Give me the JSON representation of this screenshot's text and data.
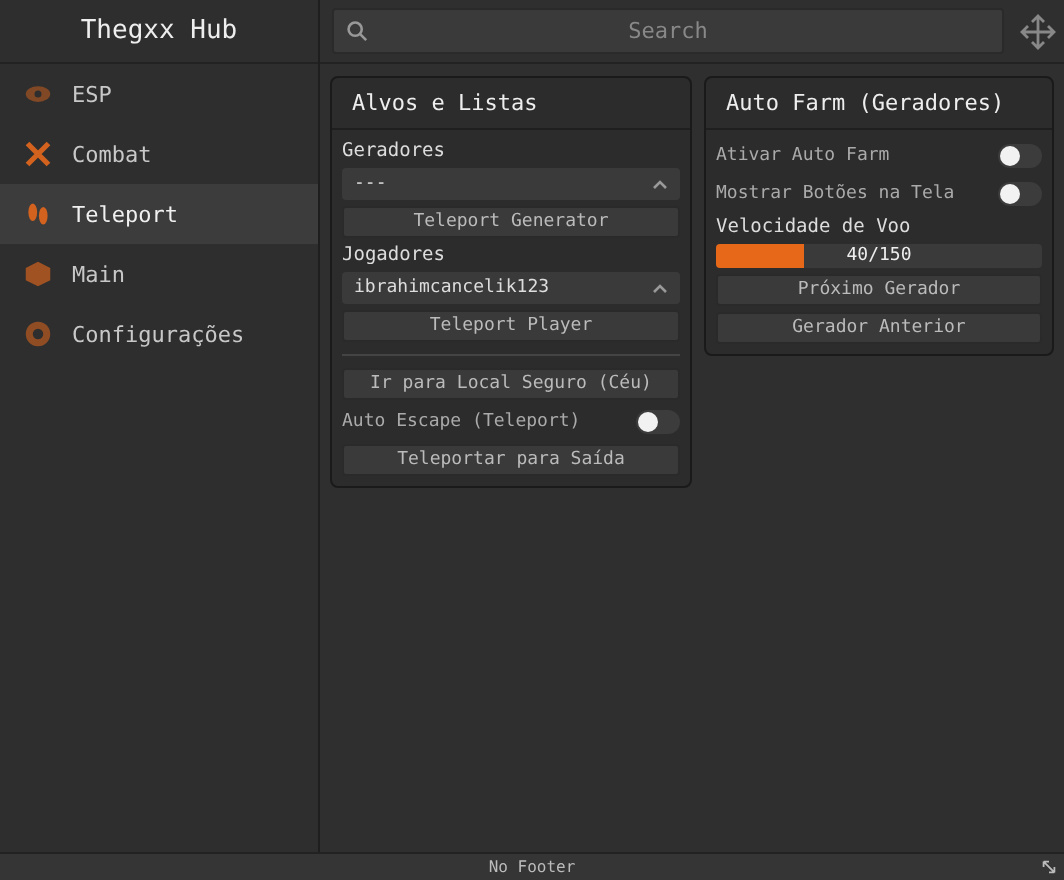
{
  "sidebar": {
    "title": "Thegxx Hub",
    "items": [
      {
        "label": "ESP",
        "selected": false
      },
      {
        "label": "Combat",
        "selected": false
      },
      {
        "label": "Teleport",
        "selected": true
      },
      {
        "label": "Main",
        "selected": false
      },
      {
        "label": "Configurações",
        "selected": false
      }
    ]
  },
  "search": {
    "placeholder": "Search"
  },
  "panels": [
    {
      "title": "Alvos e Listas",
      "items": [
        {
          "kind": "label",
          "text": "Geradores"
        },
        {
          "kind": "dropdown",
          "value": "---"
        },
        {
          "kind": "button",
          "text": "Teleport Generator"
        },
        {
          "kind": "label",
          "text": "Jogadores"
        },
        {
          "kind": "dropdown",
          "value": "ibrahimcancelik123"
        },
        {
          "kind": "button",
          "text": "Teleport Player"
        },
        {
          "kind": "divider"
        },
        {
          "kind": "button",
          "text": "Ir para Local Seguro (Céu)"
        },
        {
          "kind": "toggle",
          "text": "Auto Escape (Teleport)",
          "on": false
        },
        {
          "kind": "button",
          "text": "Teleportar para Saída"
        }
      ]
    },
    {
      "title": "Auto Farm (Geradores)",
      "items": [
        {
          "kind": "toggle",
          "text": "Ativar Auto Farm",
          "on": false
        },
        {
          "kind": "toggle",
          "text": "Mostrar Botões na Tela",
          "on": false
        },
        {
          "kind": "label",
          "text": "Velocidade de Voo"
        },
        {
          "kind": "slider",
          "reading": "40/150",
          "level": 0.267
        },
        {
          "kind": "button",
          "text": "Próximo Gerador"
        },
        {
          "kind": "button",
          "text": "Gerador Anterior"
        }
      ]
    }
  ],
  "footer": {
    "text": "No Footer"
  }
}
